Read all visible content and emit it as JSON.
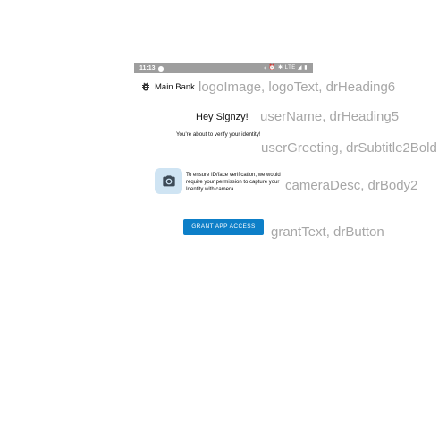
{
  "status_bar": {
    "time": "11:13",
    "icons_text": "⁎ ⏰ ✱ LTE ◢ ▮"
  },
  "header": {
    "logo_icon": "bug-icon",
    "logo_text": "Main Bank",
    "annotation": "logoImage, logoText, drHeading6"
  },
  "user": {
    "name": "Hey Signzy!",
    "name_annotation": "userName, drHeading5",
    "greeting": "You're about to verify your identity!",
    "greeting_annotation": "userGreeting, drSubtitle2Bold"
  },
  "camera": {
    "icon": "camera-icon",
    "description": "To ensure ID/face verification, we would require your permission to capture your Identity with camera.",
    "annotation": "cameraDesc, drBody2"
  },
  "grant": {
    "label": "GRANT APP ACCESS",
    "annotation": "grantText, drButton"
  },
  "colors": {
    "status_bar": "#9e9e9e",
    "button": "#0d7fc8",
    "camera_bg": "#cfe4f3",
    "annotation_text": "#a7a7a7"
  }
}
